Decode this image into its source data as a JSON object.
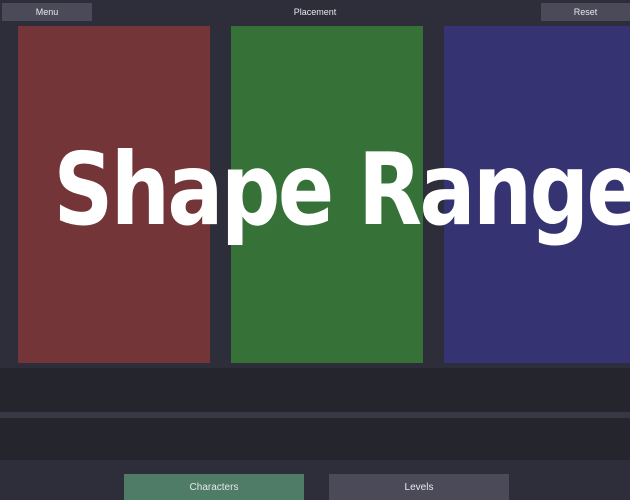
{
  "topbar": {
    "menu_label": "Menu",
    "title": "Placement",
    "reset_label": "Reset"
  },
  "overlay": {
    "text": "Shape Range"
  },
  "panels": [
    {
      "name": "red",
      "color": "#733537"
    },
    {
      "name": "green",
      "color": "#367138"
    },
    {
      "name": "blue",
      "color": "#363372"
    }
  ],
  "tabs": {
    "characters_label": "Characters",
    "levels_label": "Levels",
    "active_color": "#4e7c66",
    "inactive_color": "#4b4a58"
  }
}
